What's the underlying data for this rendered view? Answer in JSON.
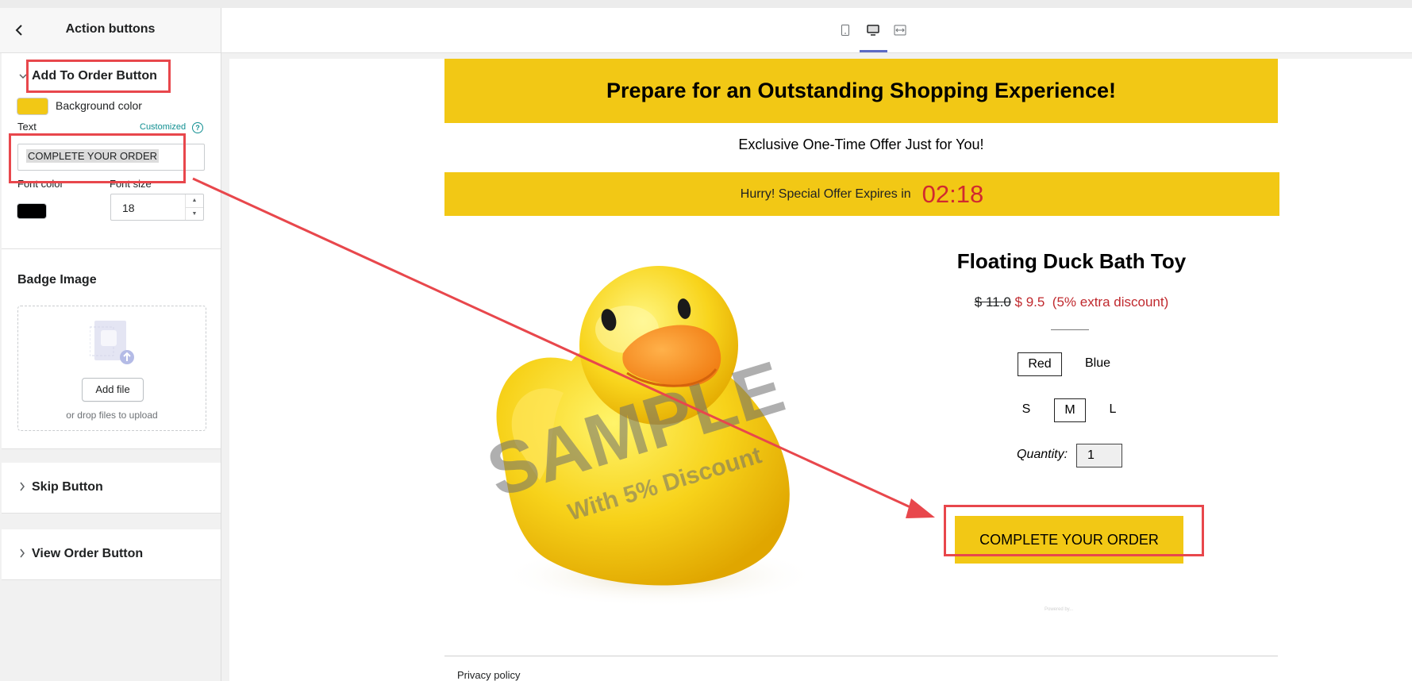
{
  "sidebar": {
    "header": {
      "title": "Action buttons",
      "back_icon": "chevron-left-icon"
    },
    "add_to_order": {
      "section_label": "Add To Order Button",
      "background_color_label": "Background color",
      "background_color": "#f2c815",
      "text_label": "Text",
      "customized_label": "Customized",
      "text_value": "COMPLETE YOUR ORDER",
      "font_color_label": "Font color",
      "font_color": "#000000",
      "font_size_label": "Font size",
      "font_size": "18"
    },
    "badge_image": {
      "title": "Badge Image",
      "add_file_label": "Add file",
      "drop_hint": "or drop files to upload"
    },
    "skip_button_label": "Skip Button",
    "view_order_button_label": "View Order Button"
  },
  "toolbar": {
    "devices": [
      "mobile-icon",
      "desktop-icon",
      "fullwidth-icon"
    ],
    "active_device": "desktop"
  },
  "preview": {
    "headline": "Prepare for an Outstanding Shopping Experience!",
    "subline": "Exclusive One-Time Offer Just for You!",
    "timer_label": "Hurry! Special Offer Expires in",
    "timer_value": "02:18",
    "product": {
      "title": "Floating Duck Bath Toy",
      "old_price": "$ 11.0",
      "new_price": "$ 9.5",
      "discount": "(5% extra discount)",
      "colors": [
        "Red",
        "Blue"
      ],
      "selected_color": "Red",
      "sizes": [
        "S",
        "M",
        "L"
      ],
      "selected_size": "M",
      "quantity_label": "Quantity:",
      "quantity": "1",
      "watermark": "SAMPLE",
      "watermark_sub": "With 5% Discount"
    },
    "cta_label": "COMPLETE YOUR ORDER",
    "tiny_text": "Powered by...",
    "footer_link": "Privacy policy"
  },
  "colors": {
    "accent_yellow": "#f2c815",
    "price_red": "#c0292e",
    "timer_red": "#d1292f",
    "annotation_red": "#e8474c",
    "tab_indicator": "#5c6ac4"
  }
}
